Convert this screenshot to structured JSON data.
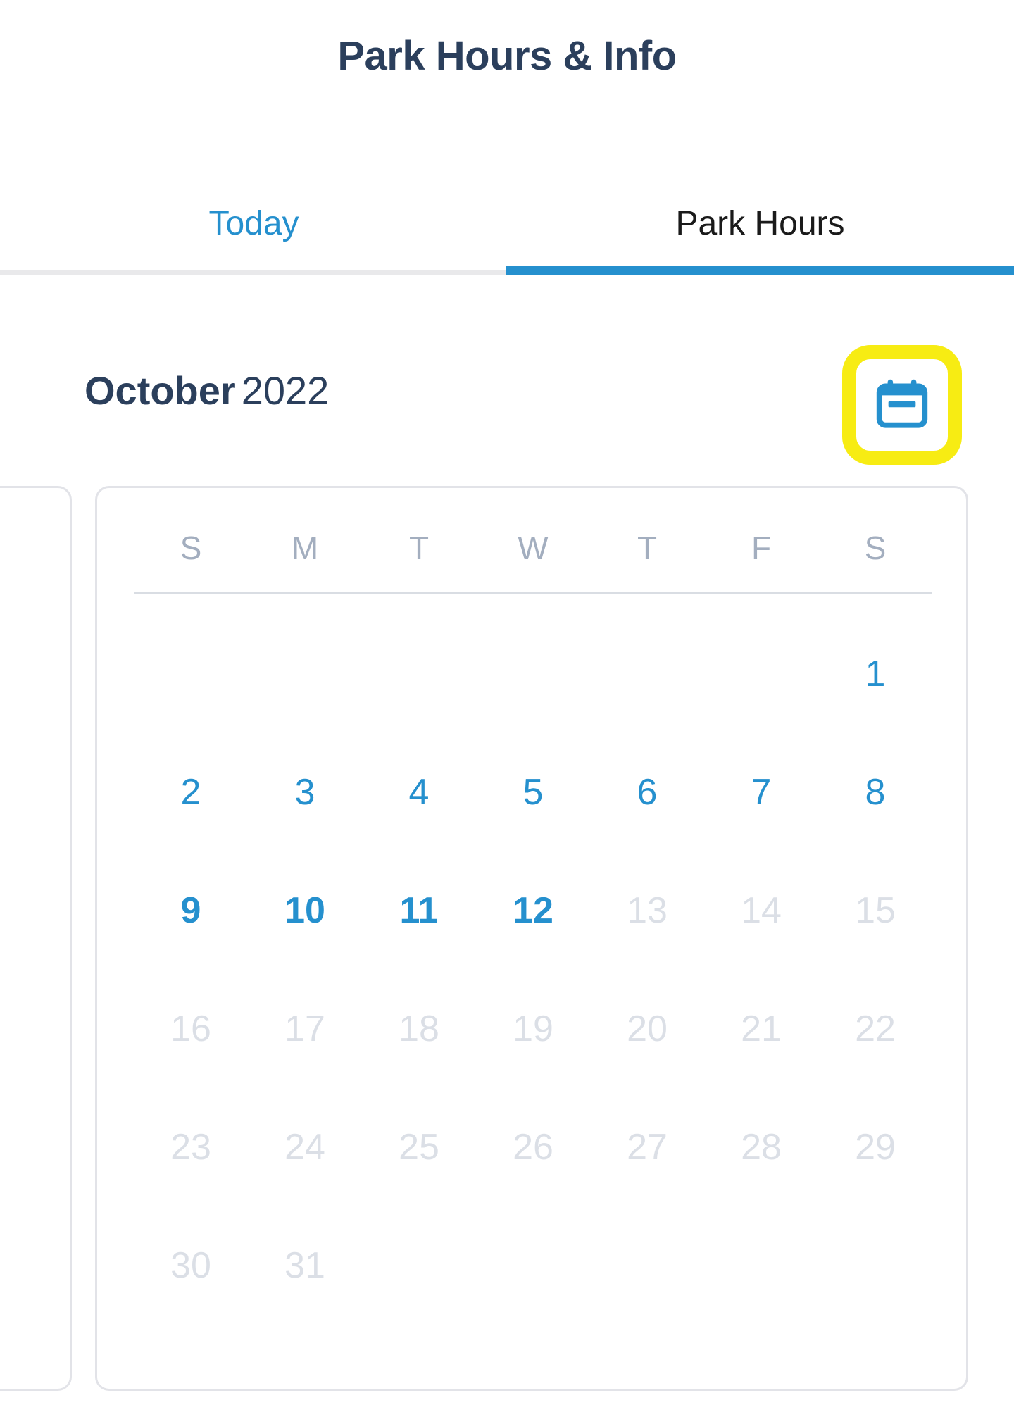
{
  "header": {
    "title": "Park Hours & Info"
  },
  "tabs": [
    {
      "id": "today",
      "label": "Today",
      "active": false
    },
    {
      "id": "park-hours",
      "label": "Park Hours",
      "active": true
    }
  ],
  "month_header": {
    "month_name": "October",
    "year": "2022",
    "calendar_button_icon": "calendar-icon"
  },
  "calendar": {
    "weekdays": [
      "S",
      "M",
      "T",
      "W",
      "T",
      "F",
      "S"
    ],
    "weeks": [
      [
        {
          "day": "",
          "state": "empty"
        },
        {
          "day": "",
          "state": "empty"
        },
        {
          "day": "",
          "state": "empty"
        },
        {
          "day": "",
          "state": "empty"
        },
        {
          "day": "",
          "state": "empty"
        },
        {
          "day": "",
          "state": "empty"
        },
        {
          "day": "1",
          "state": "enabled"
        }
      ],
      [
        {
          "day": "2",
          "state": "enabled"
        },
        {
          "day": "3",
          "state": "enabled"
        },
        {
          "day": "4",
          "state": "enabled"
        },
        {
          "day": "5",
          "state": "enabled"
        },
        {
          "day": "6",
          "state": "enabled"
        },
        {
          "day": "7",
          "state": "enabled"
        },
        {
          "day": "8",
          "state": "enabled"
        }
      ],
      [
        {
          "day": "9",
          "state": "enabled-strong"
        },
        {
          "day": "10",
          "state": "enabled-strong"
        },
        {
          "day": "11",
          "state": "enabled-strong"
        },
        {
          "day": "12",
          "state": "enabled-strong"
        },
        {
          "day": "13",
          "state": "disabled"
        },
        {
          "day": "14",
          "state": "disabled"
        },
        {
          "day": "15",
          "state": "disabled"
        }
      ],
      [
        {
          "day": "16",
          "state": "disabled"
        },
        {
          "day": "17",
          "state": "disabled"
        },
        {
          "day": "18",
          "state": "disabled"
        },
        {
          "day": "19",
          "state": "disabled"
        },
        {
          "day": "20",
          "state": "disabled"
        },
        {
          "day": "21",
          "state": "disabled"
        },
        {
          "day": "22",
          "state": "disabled"
        }
      ],
      [
        {
          "day": "23",
          "state": "disabled"
        },
        {
          "day": "24",
          "state": "disabled"
        },
        {
          "day": "25",
          "state": "disabled"
        },
        {
          "day": "26",
          "state": "disabled"
        },
        {
          "day": "27",
          "state": "disabled"
        },
        {
          "day": "28",
          "state": "disabled"
        },
        {
          "day": "29",
          "state": "disabled"
        }
      ],
      [
        {
          "day": "30",
          "state": "disabled"
        },
        {
          "day": "31",
          "state": "disabled"
        },
        {
          "day": "",
          "state": "empty"
        },
        {
          "day": "",
          "state": "empty"
        },
        {
          "day": "",
          "state": "empty"
        },
        {
          "day": "",
          "state": "empty"
        },
        {
          "day": "",
          "state": "empty"
        }
      ]
    ]
  },
  "colors": {
    "title_navy": "#2b3f5c",
    "accent_blue": "#2590ce",
    "highlight_yellow": "#f7ec13",
    "disabled_gray": "#dbdfe6",
    "weekday_gray": "#a3aebf",
    "card_border": "#e2e3e8"
  }
}
